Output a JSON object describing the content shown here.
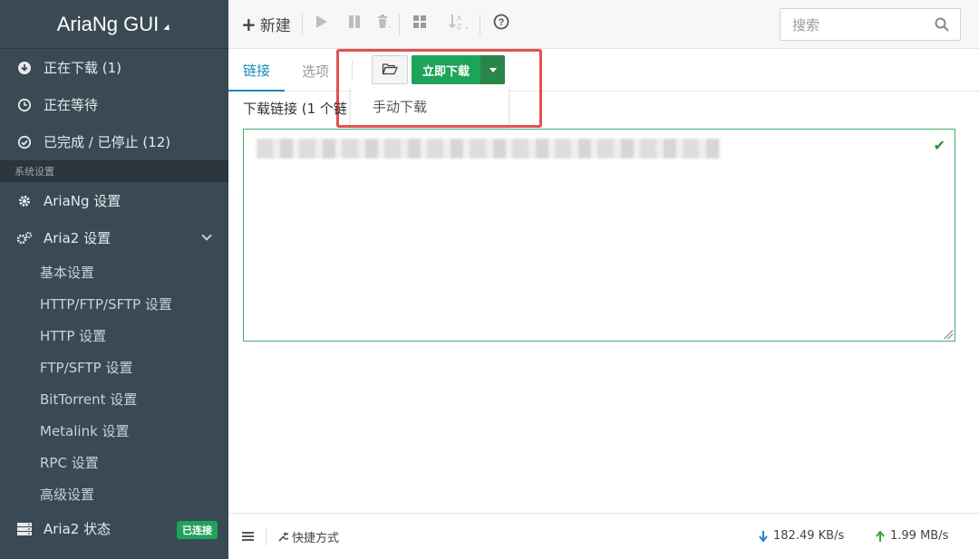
{
  "sidebar": {
    "brand": "AriaNg GUI",
    "downloads": [
      {
        "label": "正在下载 (1)",
        "icon": "download-circle-icon"
      },
      {
        "label": "正在等待",
        "icon": "clock-icon"
      },
      {
        "label": "已完成 / 已停止 (12)",
        "icon": "check-circle-icon"
      }
    ],
    "section_title": "系统设置",
    "ariang_settings": "AriaNg 设置",
    "aria2_settings": "Aria2 设置",
    "aria2_sub": [
      "基本设置",
      "HTTP/FTP/SFTP 设置",
      "HTTP 设置",
      "FTP/SFTP 设置",
      "BitTorrent 设置",
      "Metalink 设置",
      "RPC 设置",
      "高级设置"
    ],
    "aria2_status": "Aria2 状态",
    "status_badge": "已连接"
  },
  "toolbar": {
    "new_label": "新建",
    "search_placeholder": "搜索"
  },
  "tabs": [
    {
      "label": "链接",
      "active": true
    },
    {
      "label": "选项",
      "active": false
    }
  ],
  "actions": {
    "download_now": "立即下载",
    "manual_download": "手动下载"
  },
  "form": {
    "links_label": "下载链接 (1 个链"
  },
  "footer": {
    "shortcut": "快捷方式",
    "download_speed": "182.49 KB/s",
    "upload_speed": "1.99 MB/s"
  },
  "colors": {
    "sidebar_bg": "#3a4a55",
    "accent": "#1a8ab8",
    "success": "#1ea35a",
    "highlight": "#e0514f"
  }
}
